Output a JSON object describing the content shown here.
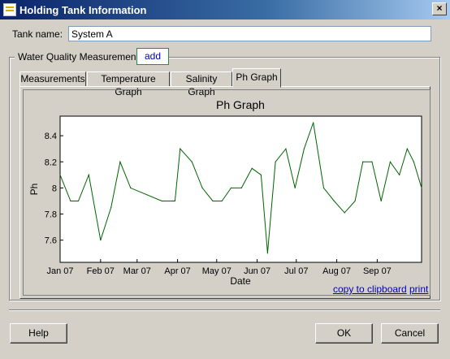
{
  "window": {
    "title": "Holding Tank Information",
    "close_glyph": "×",
    "icon": "app-icon"
  },
  "tank": {
    "label": "Tank name:",
    "value": "System A"
  },
  "water_quality": {
    "legend": "Water Quality Measurements",
    "add_label": "add"
  },
  "tabs": [
    {
      "label": "Measurements",
      "active": false
    },
    {
      "label": "Temperature Graph",
      "active": false
    },
    {
      "label": "Salinity Graph",
      "active": false
    },
    {
      "label": "Ph Graph",
      "active": true
    }
  ],
  "chart_links": {
    "copy": "copy to clipboard",
    "print": "print"
  },
  "buttons": {
    "help": "Help",
    "ok": "OK",
    "cancel": "Cancel"
  },
  "chart_data": {
    "type": "line",
    "title": "Ph Graph",
    "xlabel": "Date",
    "ylabel": "Ph",
    "ylim": [
      7.43,
      8.55
    ],
    "yticks": [
      7.6,
      7.8,
      8,
      8.2,
      8.4
    ],
    "ytick_labels": [
      "7.6",
      "7.8",
      "8",
      "8.2",
      "8.4"
    ],
    "xlim": [
      "2007-01-01",
      "2007-10-05"
    ],
    "xticks": [
      "2007-01-01",
      "2007-02-01",
      "2007-03-01",
      "2007-04-01",
      "2007-05-01",
      "2007-06-01",
      "2007-07-01",
      "2007-08-01",
      "2007-09-01"
    ],
    "xtick_labels": [
      "Jan 07",
      "Feb 07",
      "Mar 07",
      "Apr 07",
      "May 07",
      "Jun 07",
      "Jul 07",
      "Aug 07",
      "Sep 07"
    ],
    "grid": false,
    "line_color": "#006400",
    "series": [
      {
        "x": [
          "2007-01-01",
          "2007-01-09",
          "2007-01-15",
          "2007-01-23",
          "2007-02-01",
          "2007-02-09",
          "2007-02-16",
          "2007-02-24",
          "2007-03-20",
          "2007-03-30",
          "2007-04-03",
          "2007-04-12",
          "2007-04-20",
          "2007-04-28",
          "2007-05-05",
          "2007-05-12",
          "2007-05-20",
          "2007-05-28",
          "2007-06-04",
          "2007-06-09",
          "2007-06-15",
          "2007-06-23",
          "2007-06-30",
          "2007-07-07",
          "2007-07-14",
          "2007-07-22",
          "2007-07-30",
          "2007-08-07",
          "2007-08-15",
          "2007-08-21",
          "2007-08-28",
          "2007-09-04",
          "2007-09-11",
          "2007-09-18",
          "2007-09-24",
          "2007-09-29",
          "2007-10-05"
        ],
        "y": [
          8.1,
          7.9,
          7.9,
          8.1,
          7.6,
          7.85,
          8.2,
          8.0,
          7.9,
          7.9,
          8.3,
          8.2,
          8.0,
          7.9,
          7.9,
          8.0,
          8.0,
          8.15,
          8.1,
          7.5,
          8.2,
          8.3,
          8.0,
          8.3,
          8.5,
          8.0,
          7.9,
          7.81,
          7.9,
          8.2,
          8.2,
          7.9,
          8.2,
          8.1,
          8.3,
          8.2,
          8.0
        ]
      }
    ]
  }
}
